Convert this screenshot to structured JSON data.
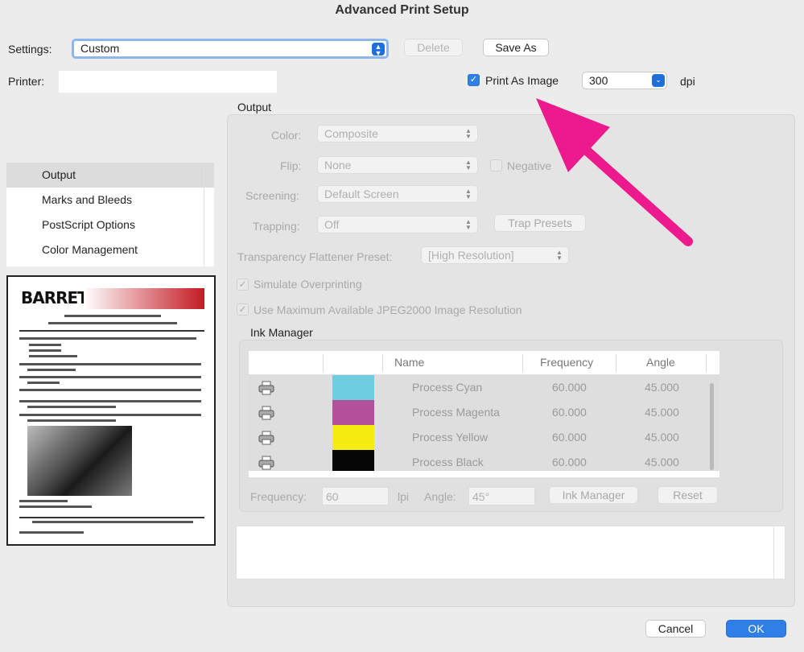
{
  "window": {
    "title": "Advanced Print Setup"
  },
  "settings": {
    "label": "Settings:",
    "value": "Custom",
    "delete_label": "Delete",
    "save_as_label": "Save As"
  },
  "printer": {
    "label": "Printer:",
    "value": ""
  },
  "print_as_image": {
    "label": "Print As Image",
    "checked": true,
    "dpi_value": "300",
    "dpi_unit": "dpi"
  },
  "sidebar": {
    "items": [
      {
        "label": "Output",
        "selected": true
      },
      {
        "label": "Marks and Bleeds"
      },
      {
        "label": "PostScript Options"
      },
      {
        "label": "Color Management"
      }
    ]
  },
  "output": {
    "header": "Output",
    "color_label": "Color:",
    "color_value": "Composite",
    "flip_label": "Flip:",
    "flip_value": "None",
    "negative_label": "Negative",
    "screening_label": "Screening:",
    "screening_value": "Default Screen",
    "trapping_label": "Trapping:",
    "trapping_value": "Off",
    "trap_presets_label": "Trap Presets",
    "flattener_label": "Transparency Flattener Preset:",
    "flattener_value": "[High Resolution]",
    "simulate_overprinting_label": "Simulate Overprinting",
    "jpeg2000_label": "Use Maximum Available JPEG2000 Image Resolution"
  },
  "ink_manager": {
    "header": "Ink Manager",
    "columns": [
      "Name",
      "Frequency",
      "Angle"
    ],
    "rows": [
      {
        "name": "Process Cyan",
        "frequency": "60.000",
        "angle": "45.000",
        "color": "#6ecde0"
      },
      {
        "name": "Process Magenta",
        "frequency": "60.000",
        "angle": "45.000",
        "color": "#b4519c"
      },
      {
        "name": "Process Yellow",
        "frequency": "60.000",
        "angle": "45.000",
        "color": "#f7ec12"
      },
      {
        "name": "Process Black",
        "frequency": "60.000",
        "angle": "45.000",
        "color": "#050505"
      }
    ],
    "frequency_label": "Frequency:",
    "frequency_value": "60",
    "frequency_unit": "lpi",
    "angle_label": "Angle:",
    "angle_value": "45°",
    "ink_manager_button": "Ink Manager",
    "reset_button": "Reset"
  },
  "preview": {
    "brand": "BARRETO"
  },
  "footer": {
    "cancel_label": "Cancel",
    "ok_label": "OK"
  },
  "annotation": {
    "arrow_color": "#ec1a8c"
  }
}
